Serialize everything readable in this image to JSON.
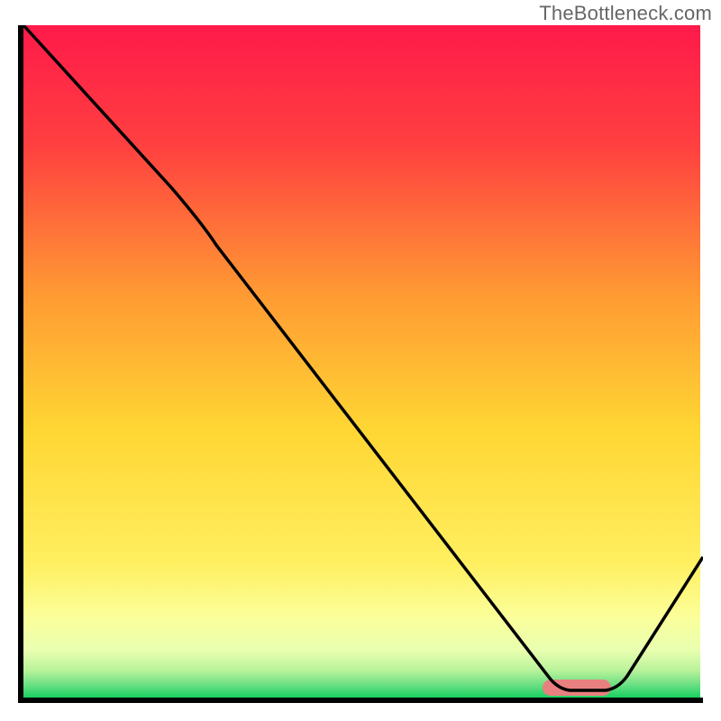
{
  "watermark": "TheBottleneck.com",
  "chart_data": {
    "type": "line",
    "title": "",
    "xlabel": "",
    "ylabel": "",
    "x_range": [
      0,
      100
    ],
    "y_range": [
      0,
      100
    ],
    "grid": false,
    "legend": false,
    "curve": {
      "name": "bottleneck-curve",
      "points": [
        {
          "x": 0,
          "y": 100
        },
        {
          "x": 22,
          "y": 76
        },
        {
          "x": 28,
          "y": 69
        },
        {
          "x": 78,
          "y": 3
        },
        {
          "x": 80,
          "y": 2
        },
        {
          "x": 86,
          "y": 2
        },
        {
          "x": 88,
          "y": 3
        },
        {
          "x": 100,
          "y": 22
        }
      ]
    },
    "optimal_marker": {
      "x_start": 78,
      "x_end": 87,
      "y": 2,
      "color": "#e88080"
    },
    "background_gradient": {
      "top": "#ff1a4a",
      "mid_upper": "#ff7a3c",
      "mid": "#ffd433",
      "mid_lower": "#fff07a",
      "lower": "#f6ffb0",
      "bottom_hint": "#9be890",
      "bottom": "#18d060"
    }
  }
}
